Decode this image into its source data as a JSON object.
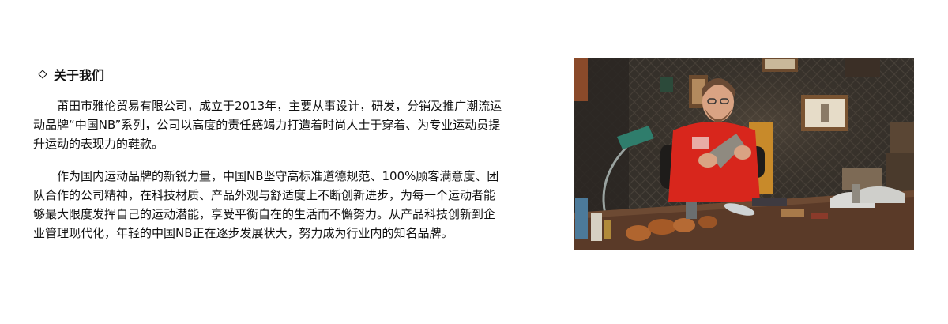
{
  "about": {
    "title": "关于我们",
    "paragraph_1": "莆田市雅伦贸易有限公司，成立于2013年，主要从事设计，研发，分销及推广潮流运动品牌“中国NB”系列，公司以高度的责任感竭力打造着时尚人士于穿着、为专业运动员提升运动的表现力的鞋款。",
    "paragraph_2": "作为国内运动品牌的新锐力量，中国NB坚守高标准道德规范、100%顾客满意度、团队合作的公司精神，在科技材质、产品外观与舒适度上不断创新进步，为每一个运动者能够最大限度发挥自己的运动潜能，享受平衡自在的生活而不懈努力。从产品科技创新到企业管理现代化，年轻的中国NB正在逐步发展状大，努力成为行业内的知名品牌。"
  },
  "photo": {
    "subject": "shoemaker-workshop",
    "colors": {
      "shirt": "#d8261c",
      "wall": "#37322c",
      "table": "#5a3a28",
      "leather": "#b0652f",
      "lamp": "#2f7d6c"
    }
  }
}
